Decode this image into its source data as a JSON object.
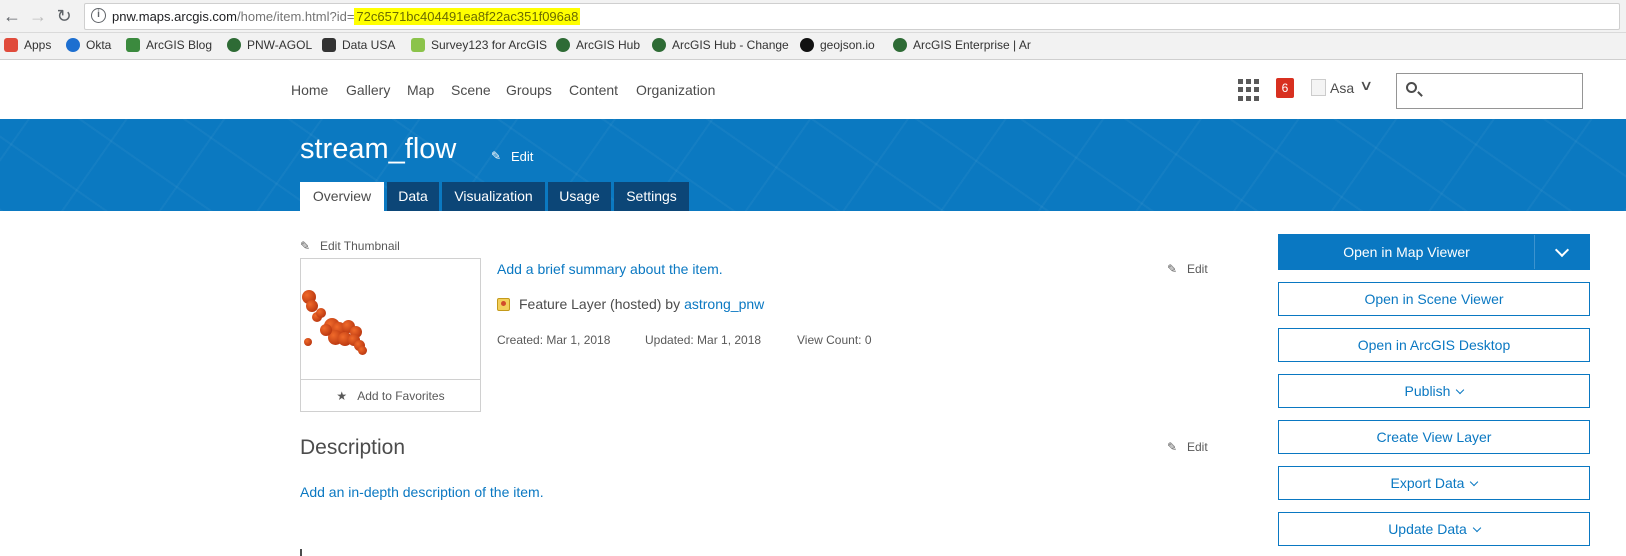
{
  "browser": {
    "back_glyph": "←",
    "forward_glyph": "→",
    "reload_glyph": "↻",
    "url_host": "pnw.maps.arcgis.com",
    "url_path": "/home/item.html?id=",
    "url_item_id": "72c6571bc404491ea8f22ac351f096a8",
    "bookmarks": [
      {
        "label": "Apps",
        "icon": "apps-grid-icon",
        "color": "#e04b3b"
      },
      {
        "label": "Okta",
        "icon": "okta-icon",
        "color": "#1d6fd0"
      },
      {
        "label": "ArcGIS Blog",
        "icon": "arcgis-blog-icon",
        "color": "#3b8a3e"
      },
      {
        "label": "PNW-AGOL",
        "icon": "globe-icon",
        "color": "#2e6b35"
      },
      {
        "label": "Data USA",
        "icon": "data-usa-icon",
        "color": "#333333"
      },
      {
        "label": "Survey123 for ArcGIS",
        "icon": "survey123-icon",
        "color": "#8bc34a"
      },
      {
        "label": "ArcGIS Hub",
        "icon": "globe-icon",
        "color": "#2e6b35"
      },
      {
        "label": "ArcGIS Hub - Change",
        "icon": "globe-icon",
        "color": "#2e6b35"
      },
      {
        "label": "geojson.io",
        "icon": "geojson-icon",
        "color": "#111111"
      },
      {
        "label": "ArcGIS Enterprise | Ar",
        "icon": "globe-icon",
        "color": "#2e6b35"
      }
    ]
  },
  "header": {
    "nav": [
      "Home",
      "Gallery",
      "Map",
      "Scene",
      "Groups",
      "Content",
      "Organization"
    ],
    "notification_count": "6",
    "username": "Asa",
    "search_placeholder": ""
  },
  "item": {
    "title": "stream_flow",
    "title_edit": "Edit",
    "tabs": [
      "Overview",
      "Data",
      "Visualization",
      "Usage",
      "Settings"
    ],
    "edit_thumbnail": "Edit Thumbnail",
    "add_to_favorites": "Add to Favorites",
    "summary_link": "Add a brief summary about the item.",
    "summary_edit": "Edit",
    "layer_type": "Feature Layer (hosted) by",
    "owner": "astrong_pnw",
    "created": "Created: Mar 1, 2018",
    "updated": "Updated: Mar 1, 2018",
    "view_count": "View Count: 0",
    "description_title": "Description",
    "description_edit": "Edit",
    "description_link": "Add an in-depth description of the item."
  },
  "actions": {
    "open_map_viewer": "Open in Map Viewer",
    "open_scene_viewer": "Open in Scene Viewer",
    "open_desktop": "Open in ArcGIS Desktop",
    "publish": "Publish",
    "create_view_layer": "Create View Layer",
    "export_data": "Export Data",
    "update_data": "Update Data"
  },
  "colors": {
    "brand_blue": "#0b79c1",
    "tab_dark": "#0c4677",
    "link": "#0a78c2",
    "notification": "#d83020",
    "url_highlight": "#ffff00"
  }
}
